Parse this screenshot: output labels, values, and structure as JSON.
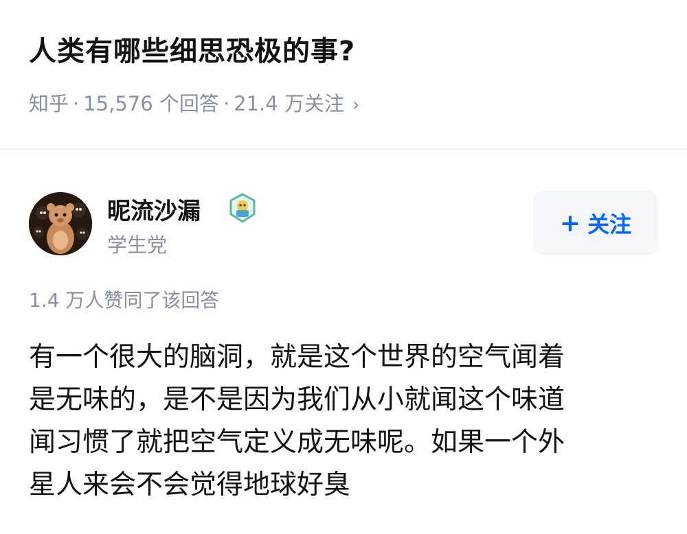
{
  "question": {
    "title": "人类有哪些细思恐极的事?",
    "meta": {
      "source": "知乎",
      "answers": "15,576 个回答",
      "followers": "21.4 万关注",
      "chevron": "›"
    }
  },
  "author": {
    "name": "昵流沙漏",
    "bio": "学生党",
    "avatar_icon": "avatar-image",
    "badge_icon": "verified-badge-icon"
  },
  "follow": {
    "plus": "+",
    "label": "关注"
  },
  "answer": {
    "vote_summary": "1.4 万人赞同了该回答",
    "lines": [
      "有一个很大的脑洞，就是这个世界的空气闻着",
      "是无味的，是不是因为我们从小就闻这个味道",
      "闻习惯了就把空气定义成无味呢。如果一个外",
      "星人来会不会觉得地球好臭"
    ]
  },
  "colors": {
    "accent": "#0066ff",
    "meta_text": "#8590a6",
    "button_bg": "#f4f6f9"
  }
}
